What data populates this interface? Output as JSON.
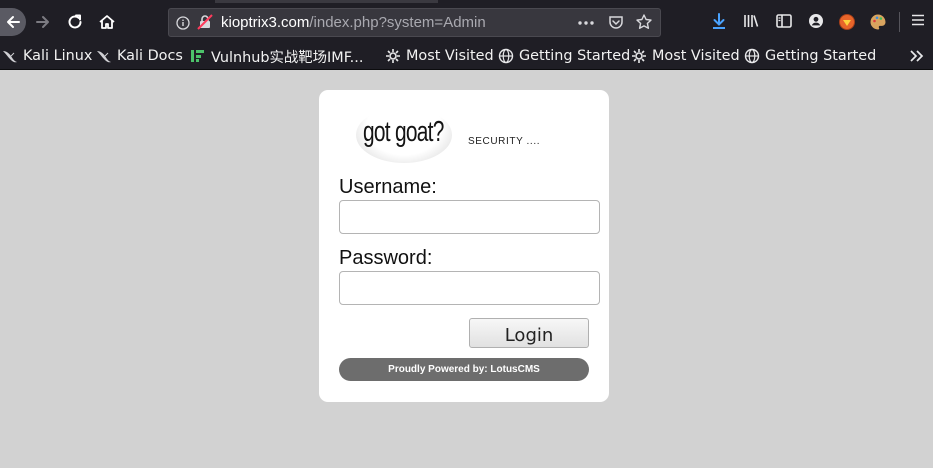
{
  "browser": {
    "url_host": "kioptrix3.com",
    "url_path": "/index.php?system=Admin",
    "icons": [
      "back-icon",
      "forward-icon",
      "reload-icon",
      "home-icon",
      "info-icon",
      "insecure-lock-icon",
      "more-icon",
      "pocket-icon",
      "star-icon",
      "download-icon",
      "library-icon",
      "sidebar-icon",
      "account-icon",
      "extension-icon",
      "palette-icon",
      "menu-icon"
    ]
  },
  "bookmarks": [
    {
      "label": "Kali Linux",
      "icon": "kali-dragon-icon"
    },
    {
      "label": "Kali Docs",
      "icon": "kali-dragon-icon"
    },
    {
      "label": "Vulnhub实战靶场IMF...",
      "icon": "vulnhub-icon"
    },
    {
      "label": "Most Visited",
      "icon": "gear-icon"
    },
    {
      "label": "Getting Started",
      "icon": "globe-icon"
    },
    {
      "label": "Most Visited",
      "icon": "gear-icon"
    },
    {
      "label": "Getting Started",
      "icon": "globe-icon"
    }
  ],
  "login": {
    "logo_text": "got goat?",
    "security_text": "SECURITY ....",
    "username_label": "Username:",
    "username_value": "",
    "password_label": "Password:",
    "password_value": "",
    "login_button": "Login",
    "powered_by": "Proudly Powered by: LotusCMS"
  },
  "colors": {
    "chrome_bg": "#1f1e25",
    "urlbar_bg": "#38373e",
    "page_bg": "#d2d2d2",
    "card_bg": "#ffffff",
    "powered_bar": "#6d6d6d",
    "download_accent": "#4aa3ff"
  }
}
